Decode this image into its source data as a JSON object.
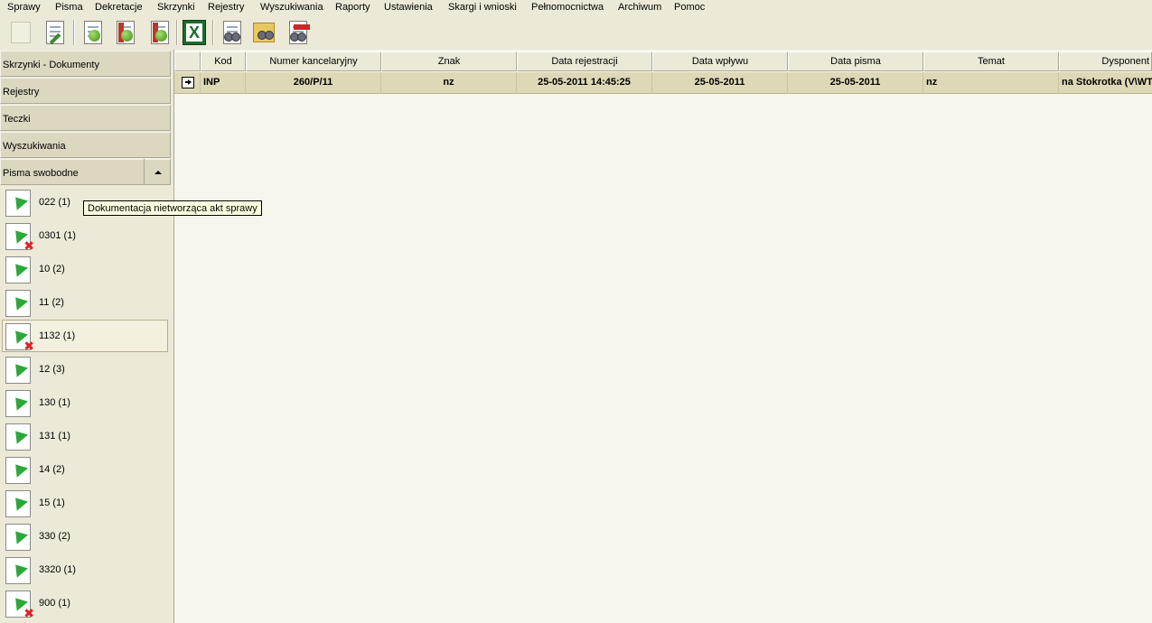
{
  "menu": [
    {
      "label": "Sprawy"
    },
    {
      "label": "Pisma"
    },
    {
      "label": "Dekretacje"
    },
    {
      "label": "Skrzynki"
    },
    {
      "label": "Rejestry"
    },
    {
      "label": "Wyszukiwania"
    },
    {
      "label": "Raporty"
    },
    {
      "label": "Ustawienia"
    },
    {
      "label": "Skargi i wnioski"
    },
    {
      "label": "Pełnomocnictwa"
    },
    {
      "label": "Archiwum"
    },
    {
      "label": "Pomoc"
    }
  ],
  "toolbar_icons": [
    "new-document-icon",
    "edit-document-icon",
    "refresh-list-icon",
    "refresh-red-list-icon",
    "refresh-red-list-2-icon",
    "excel-export-icon",
    "search-document-icon",
    "search-folder-icon",
    "search-sealed-document-icon"
  ],
  "sidebar": {
    "sections": [
      {
        "label": "Skrzynki - Dokumenty"
      },
      {
        "label": "Rejestry"
      },
      {
        "label": "Teczki"
      },
      {
        "label": "Wyszukiwania"
      },
      {
        "label": "Pisma swobodne"
      }
    ],
    "items": [
      {
        "label": "022 (1)",
        "flag": false
      },
      {
        "label": "0301 (1)",
        "flag": true
      },
      {
        "label": "10 (2)",
        "flag": false
      },
      {
        "label": "11 (2)",
        "flag": false
      },
      {
        "label": "1132 (1)",
        "flag": true
      },
      {
        "label": "12 (3)",
        "flag": false
      },
      {
        "label": "130 (1)",
        "flag": false
      },
      {
        "label": "131 (1)",
        "flag": false
      },
      {
        "label": "14 (2)",
        "flag": false
      },
      {
        "label": "15 (1)",
        "flag": false
      },
      {
        "label": "330 (2)",
        "flag": false
      },
      {
        "label": "3320 (1)",
        "flag": false
      },
      {
        "label": "900 (1)",
        "flag": true
      }
    ]
  },
  "tooltip": "Dokumentacja nietworząca akt sprawy",
  "table": {
    "columns": [
      "Kod",
      "Numer kancelaryjny",
      "Znak",
      "Data rejestracji",
      "Data wpływu",
      "Data pisma",
      "Temat",
      "Dysponent"
    ],
    "rows": [
      [
        "INP",
        "260/P/11",
        "nz",
        "25-05-2011 14:45:25",
        "25-05-2011",
        "25-05-2011",
        "nz",
        "na Stokrotka (V\\WT"
      ]
    ]
  },
  "colors": {
    "background": "#ece9d8",
    "row_selected": "#ddd9b6",
    "tooltip": "#ffffe1"
  }
}
